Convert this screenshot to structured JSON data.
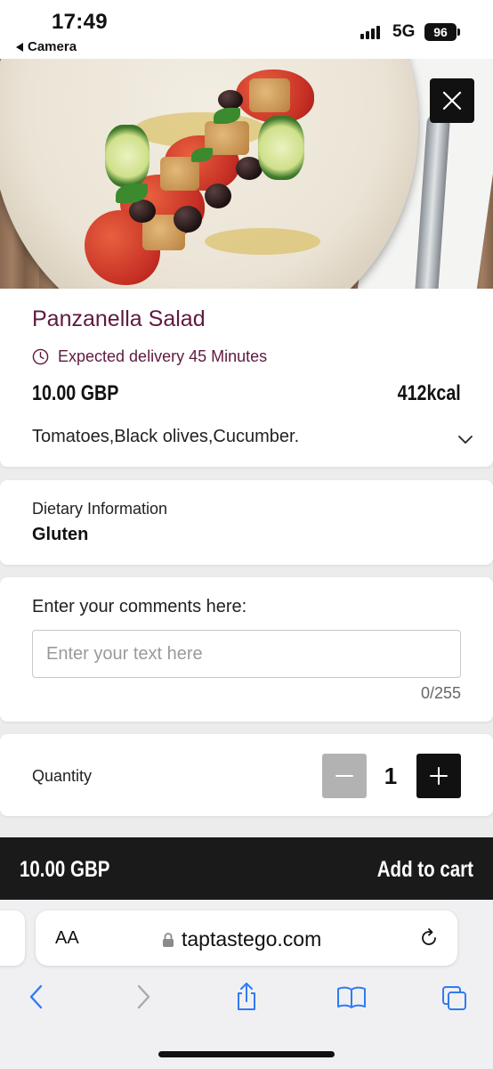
{
  "status_bar": {
    "time": "17:49",
    "back_app": "Camera",
    "network": "5G",
    "battery": "96"
  },
  "hero": {
    "image": "panzanella-salad-photo",
    "close_icon": "close-icon"
  },
  "product": {
    "name": "Panzanella Salad",
    "delivery": "Expected delivery 45 Minutes",
    "price": "10.00 GBP",
    "kcal": "412kcal",
    "ingredients": "Tomatoes,Black olives,Cucumber."
  },
  "dietary": {
    "label": "Dietary Information",
    "value": "Gluten"
  },
  "comments": {
    "label": "Enter your comments here:",
    "placeholder": "Enter your text here",
    "value": "",
    "counter": "0/255"
  },
  "quantity": {
    "label": "Quantity",
    "value": "1"
  },
  "cart": {
    "total": "10.00 GBP",
    "button": "Add to cart"
  },
  "browser": {
    "text_size_label": "AA",
    "url": "taptastego.com"
  },
  "colors": {
    "accent": "#5f1a40",
    "dark": "#111111",
    "cart_bar": "#1a1a1a",
    "disabled": "#b2b2b2",
    "safari_blue": "#2f7bf5"
  }
}
